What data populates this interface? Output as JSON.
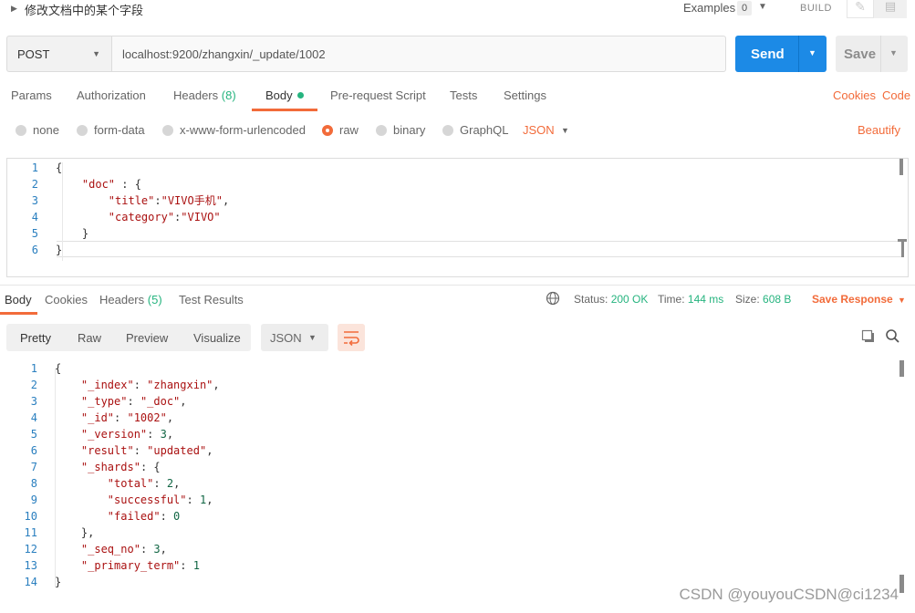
{
  "header": {
    "title": "修改文档中的某个字段",
    "examples_label": "Examples",
    "examples_count": "0",
    "build_label": "BUILD"
  },
  "request": {
    "method": "POST",
    "url": "localhost:9200/zhangxin/_update/1002",
    "send_label": "Send",
    "save_label": "Save"
  },
  "request_tabs": {
    "params": "Params",
    "authorization": "Authorization",
    "headers": "Headers",
    "headers_count": "(8)",
    "body": "Body",
    "prerequest": "Pre-request Script",
    "tests": "Tests",
    "settings": "Settings",
    "cookies": "Cookies",
    "code": "Code"
  },
  "body_types": {
    "none": "none",
    "form_data": "form-data",
    "urlencoded": "x-www-form-urlencoded",
    "raw": "raw",
    "binary": "binary",
    "graphql": "GraphQL",
    "format": "JSON",
    "beautify": "Beautify"
  },
  "request_body": {
    "line_numbers": [
      "1",
      "2",
      "3",
      "4",
      "5",
      "6"
    ],
    "lines": [
      "{",
      "    \"doc\" : {",
      "        \"title\":\"VIVO手机\",",
      "        \"category\":\"VIVO\"",
      "    }",
      "}"
    ]
  },
  "response_tabs": {
    "body": "Body",
    "cookies": "Cookies",
    "headers": "Headers",
    "headers_count": "(5)",
    "test_results": "Test Results"
  },
  "response_meta": {
    "status_label": "Status:",
    "status_value": "200 OK",
    "time_label": "Time:",
    "time_value": "144 ms",
    "size_label": "Size:",
    "size_value": "608 B",
    "save_response": "Save Response"
  },
  "response_toolbar": {
    "pretty": "Pretty",
    "raw": "Raw",
    "preview": "Preview",
    "visualize": "Visualize",
    "format": "JSON"
  },
  "response_body": {
    "line_numbers": [
      "1",
      "2",
      "3",
      "4",
      "5",
      "6",
      "7",
      "8",
      "9",
      "10",
      "11",
      "12",
      "13",
      "14"
    ],
    "lines": [
      "{",
      "    \"_index\": \"zhangxin\",",
      "    \"_type\": \"_doc\",",
      "    \"_id\": \"1002\",",
      "    \"_version\": 3,",
      "    \"result\": \"updated\",",
      "    \"_shards\": {",
      "        \"total\": 2,",
      "        \"successful\": 1,",
      "        \"failed\": 0",
      "    },",
      "    \"_seq_no\": 3,",
      "    \"_primary_term\": 1",
      "}"
    ]
  },
  "watermark": "CSDN @youyouCSDN@ci1234",
  "icons": [
    "caret-right-icon",
    "chevron-down-icon",
    "pencil-icon",
    "comment-icon",
    "globe-icon",
    "copy-icon",
    "search-icon",
    "wrap-lines-icon"
  ],
  "colors": {
    "accent": "#f26b3a",
    "send": "#1c8ae6",
    "success": "#26b47f",
    "line_number": "#2a7fbf",
    "string": "#aa1111"
  }
}
